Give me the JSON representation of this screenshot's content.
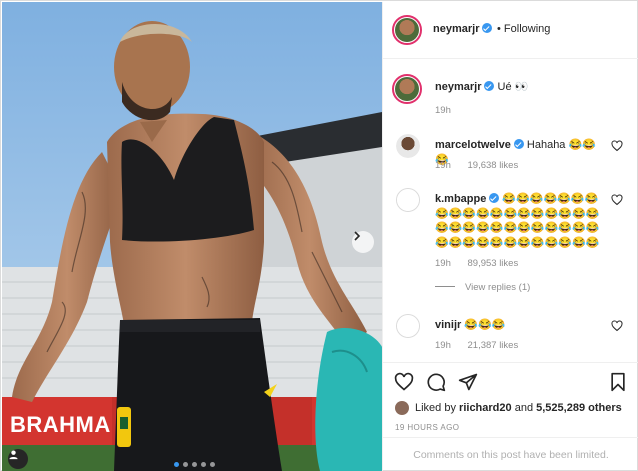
{
  "post": {
    "username": "neymarjr",
    "follow_status": "• Following",
    "caption": {
      "username": "neymarjr",
      "text": "Ué 👀",
      "time": "19h"
    },
    "image_banner": "BRAHMA",
    "carousel": {
      "count": 5,
      "active_index": 0
    }
  },
  "comments": [
    {
      "username": "marcelotwelve",
      "verified": true,
      "text": "Hahaha 😂😂😂",
      "time": "19h",
      "likes": "19,638 likes"
    },
    {
      "username": "k.mbappe",
      "verified": true,
      "text": "😂😂😂😂😂😂😂😂😂😂😂😂😂😂😂😂😂😂😂😂😂😂😂😂😂😂😂😂😂😂😂😂😂😂😂😂😂😂😂😂😂😂😂",
      "time": "19h",
      "likes": "89,953 likes",
      "view_replies": "View replies (1)"
    },
    {
      "username": "vinijr",
      "verified": false,
      "text": "😂😂😂",
      "time": "19h",
      "likes": "21,387 likes"
    }
  ],
  "actions": {
    "icons": [
      "heart-icon",
      "comment-icon",
      "share-icon",
      "bookmark-icon"
    ],
    "liked_by_prefix": "Liked by",
    "liked_by_user": "riichard20",
    "liked_by_and": "and",
    "liked_by_count": "5,525,289 others",
    "posted_ago": "19 HOURS AGO",
    "comments_limited": "Comments on this post have been limited."
  },
  "colors": {
    "accent_blue": "#3897f0",
    "story_ring": "#e1306c",
    "muted_text": "#8e8e8e"
  }
}
